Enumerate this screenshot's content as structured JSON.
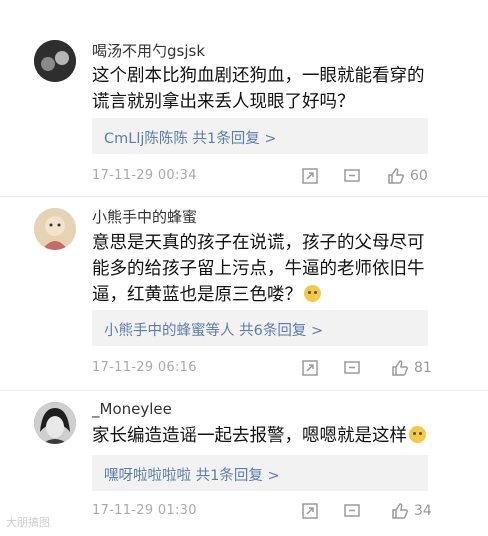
{
  "comments": [
    {
      "username": "喝汤不用勺gsjsk",
      "lines": [
        "这个剧本比狗血剧还狗血，一眼就能看穿的",
        "谎言就别拿出来丢人现眼了好吗？"
      ],
      "reply": "CmLlj陈陈陈  共1条回复 >",
      "time": "17-11-29 00:34",
      "likes": "60"
    },
    {
      "username": "小熊手中的蜂蜜",
      "lines": [
        "意思是天真的孩子在说谎，孩子的父母尽可",
        "能多的给孩子留上污点，牛逼的老师依旧牛",
        "逼，红黄蓝也是原三色喽？"
      ],
      "reply": "小熊手中的蜂蜜等人  共6条回复 >",
      "time": "17-11-29 06:16",
      "likes": "81"
    },
    {
      "username": "_Moneylee",
      "lines": [
        "家长编造造谣一起去报警，嗯嗯就是这样"
      ],
      "reply": "嘿呀啦啦啦啦  共1条回复 >",
      "time": "17-11-29 01:30",
      "likes": "34"
    }
  ],
  "icons": [
    "share-icon",
    "comment-icon",
    "thumbs-up-icon"
  ],
  "watermark": "大朋搞图",
  "colors": {
    "link": "#5b7ea8",
    "reply_bg": "#f2f2f2",
    "meta": "#aaaaaa"
  }
}
